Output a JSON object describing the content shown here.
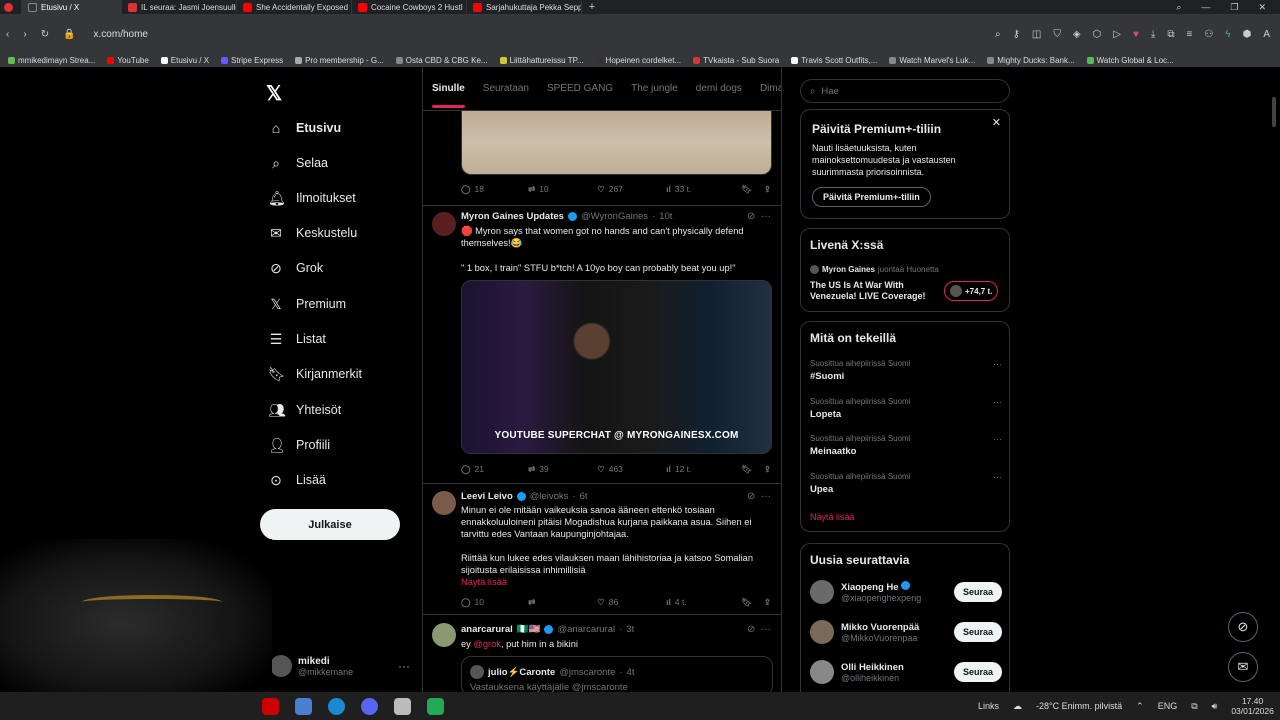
{
  "browser": {
    "tabs": [
      {
        "label": "Etusivu / X",
        "active": true
      },
      {
        "label": "IL seuraa: Jasmi Joensuulle"
      },
      {
        "label": "She Accidentally Exposed"
      },
      {
        "label": "Cocaine Cowboys 2 Hustl"
      },
      {
        "label": "Sarjahukuttaja Pekka Sepp"
      }
    ],
    "url": "x.com/home",
    "bookmarks": [
      "mmikedimayn Strea...",
      "YouTube",
      "Etusivu / X",
      "Stripe Express",
      "Pro membership - G...",
      "Osta CBD & CBG Ke...",
      "Liittähattureissu TP...",
      "Hopeinen cordelket...",
      "TVkaista - Sub Suora",
      "Travis Scott Outfits,...",
      "Watch Marvel's Luk...",
      "Mighty Ducks: Bank...",
      "Watch Global & Loc..."
    ]
  },
  "nav": {
    "items": [
      {
        "label": "Etusivu",
        "icon": "home-icon"
      },
      {
        "label": "Selaa",
        "icon": "search-icon"
      },
      {
        "label": "Ilmoitukset",
        "icon": "bell-icon"
      },
      {
        "label": "Keskustelu",
        "icon": "mail-icon"
      },
      {
        "label": "Grok",
        "icon": "grok-icon"
      },
      {
        "label": "Premium",
        "icon": "x-icon"
      },
      {
        "label": "Listat",
        "icon": "list-icon"
      },
      {
        "label": "Kirjanmerkit",
        "icon": "bookmark-icon"
      },
      {
        "label": "Yhteisöt",
        "icon": "people-icon"
      },
      {
        "label": "Profiili",
        "icon": "person-icon"
      },
      {
        "label": "Lisää",
        "icon": "more-circle-icon"
      }
    ],
    "post_button": "Julkaise",
    "user": {
      "name": "mikedi",
      "handle": "@mikkemane"
    }
  },
  "timeline": {
    "tabs": [
      "Sinulle",
      "Seurataan",
      "SPEED GANG",
      "The jungle",
      "demi dogs",
      "Dima's Di"
    ],
    "tweets": [
      {
        "replies": "18",
        "reposts": "10",
        "likes": "267",
        "views": "33 t."
      },
      {
        "name": "Myron Gaines Updates",
        "handle": "@WyronGaines",
        "time": "10t",
        "text1": "🛑 Myron says that women got no hands and can't physically defend themselves!😂",
        "text2": "\" 1 box, I train\" STFU b*tch! A 10yo boy can probably beat you up!\"",
        "media_caption": "YOUTUBE SUPERCHAT @ MYRONGAINESX.COM",
        "replies": "21",
        "reposts": "39",
        "likes": "463",
        "views": "12 t."
      },
      {
        "name": "Leevi Leivo",
        "handle": "@leivoks",
        "time": "6t",
        "text1": "Minun ei ole mitään vaikeuksia sanoa ääneen ettenkö tosiaan ennakkoluuloineni pitäisi Mogadishua kurjana paikkana asua. Siihen ei tarvittu edes Vantaan kaupunginjohtajaa.",
        "text2": "Riittää kun lukee edes vilauksen maan lähihistoriaa ja katsoo Somalian sijoitusta erilaisissa inhimillisiä",
        "show_more": "Näytä lisää",
        "replies": "10",
        "reposts": "",
        "likes": "86",
        "views": "4 t."
      },
      {
        "name": "anarcarural",
        "flags": "🇳🇬🇺🇸",
        "handle": "@anarcarural",
        "time": "3t",
        "mention": "@grok",
        "text": ", put him in a bikini",
        "quote": {
          "name": "julio⚡Caronte",
          "handle": "@jmscaronte",
          "time": "4t",
          "reply_to": "Vastauksena käyttäjälle @jmscaronte"
        }
      }
    ]
  },
  "sidebar": {
    "search_placeholder": "Hae",
    "premium": {
      "title": "Päivitä Premium+-tiliin",
      "body": "Nauti lisäetuuksista, kuten mainoksettomuudesta ja vastausten suurimmasta priorisoinnista.",
      "button": "Päivitä Premium+-tiliin"
    },
    "live": {
      "title": "Livenä X:ssä",
      "host": "Myron Gaines",
      "host_suffix": "juontaa Huonetta",
      "headline": "The US Is At War With Venezuela! LIVE Coverage!",
      "count": "+74,7 t."
    },
    "trends": {
      "title": "Mitä on tekeillä",
      "items": [
        {
          "context": "Suosittua aihepiirissä Suomi",
          "name": "#Suomi"
        },
        {
          "context": "Suosittua aihepiirissä Suomi",
          "name": "Lopeta"
        },
        {
          "context": "Suosittua aihepiirissä Suomi",
          "name": "Meinaatko"
        },
        {
          "context": "Suosittua aihepiirissä Suomi",
          "name": "Upea"
        }
      ],
      "show_more": "Näytä lisää"
    },
    "who_to_follow": {
      "title": "Uusia seurattavia",
      "items": [
        {
          "name": "Xiaopeng He",
          "handle": "@xiaopenghexpeng"
        },
        {
          "name": "Mikko Vuorenpää",
          "handle": "@MikkoVuorenpaa"
        },
        {
          "name": "Olli Heikkinen",
          "handle": "@olliheikkinen"
        }
      ],
      "follow_label": "Seuraa"
    }
  },
  "taskbar": {
    "links": "Links",
    "weather": "-28°C  Enimm. pilvistä",
    "lang": "ENG",
    "time": "17.40",
    "date": "03/01/2026"
  },
  "colors": {
    "accent": "#e0245e",
    "bg": "#000000",
    "verified": "#1d9bf0"
  }
}
